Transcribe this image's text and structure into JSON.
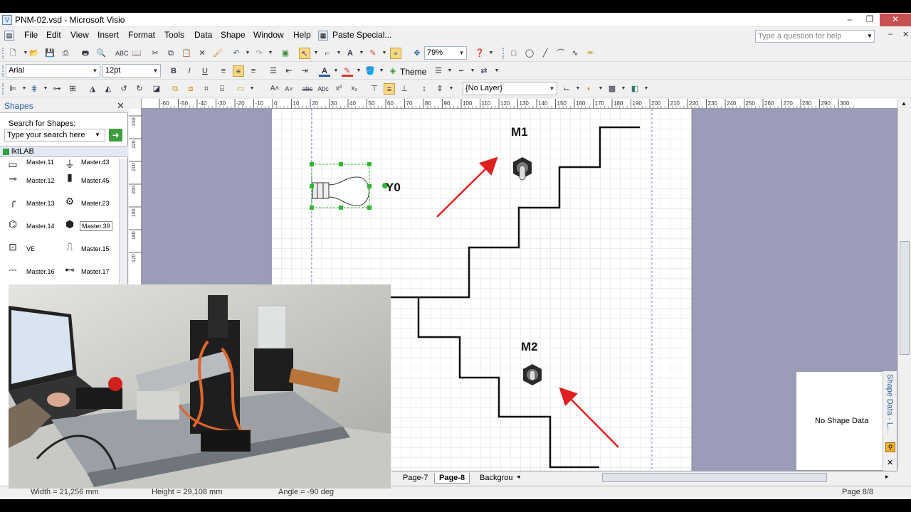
{
  "window": {
    "title": "PNM-02.vsd - Microsoft Visio",
    "minimize": "–",
    "restore": "❐",
    "close": "✕"
  },
  "menu": {
    "items": [
      "File",
      "Edit",
      "View",
      "Insert",
      "Format",
      "Tools",
      "Data",
      "Shape",
      "Window",
      "Help"
    ],
    "paste_special": "Paste Special...",
    "help_placeholder": "Type a question for help"
  },
  "toolbar": {
    "zoom": "79%",
    "font": "Arial",
    "font_size": "12pt",
    "bold": "B",
    "italic": "I",
    "underline": "U",
    "theme_label": "Theme",
    "layer": "{No Layer}"
  },
  "shapes_pane": {
    "title": "Shapes",
    "search_label": "Search for Shapes:",
    "search_placeholder": "Type your search here",
    "stencil": "iktLAB",
    "masters": [
      "Master.11",
      "Master.43",
      "Master.12",
      "Master.45",
      "Master.13",
      "Master.23",
      "Master.14",
      "Master.39",
      "VE",
      "Master.15",
      "Master.16",
      "Master.17"
    ]
  },
  "ruler": {
    "h_ticks": [
      "-60",
      "-50",
      "-40",
      "-30",
      "-20",
      "-10",
      "0",
      "10",
      "20",
      "30",
      "40",
      "50",
      "60",
      "70",
      "80",
      "90",
      "100",
      "110",
      "120",
      "130",
      "140",
      "150",
      "160",
      "170",
      "180",
      "190",
      "200",
      "210",
      "220",
      "230",
      "240",
      "250",
      "260",
      "270",
      "280",
      "290",
      "300"
    ],
    "v_ticks": [
      "230",
      "220",
      "210",
      "200",
      "190",
      "180",
      "170"
    ]
  },
  "drawing": {
    "label_y0": "Y0",
    "label_m1": "M1",
    "label_m2": "M2"
  },
  "page_tabs": [
    "Page-7",
    "Page-8",
    "Backgrou"
  ],
  "active_tab": "Page-8",
  "shape_data": {
    "empty": "No Shape Data",
    "side_title": "Shape Data - L..."
  },
  "status": {
    "width": "Width = 21,256 mm",
    "height": "Height = 29,108 mm",
    "angle": "Angle = -90 deg",
    "page": "Page 8/8"
  },
  "colors": {
    "canvas_bg": "#9a9cb8",
    "page_bg": "#ffffff",
    "arrow": "#e02020",
    "selection": "#2fb82f"
  }
}
